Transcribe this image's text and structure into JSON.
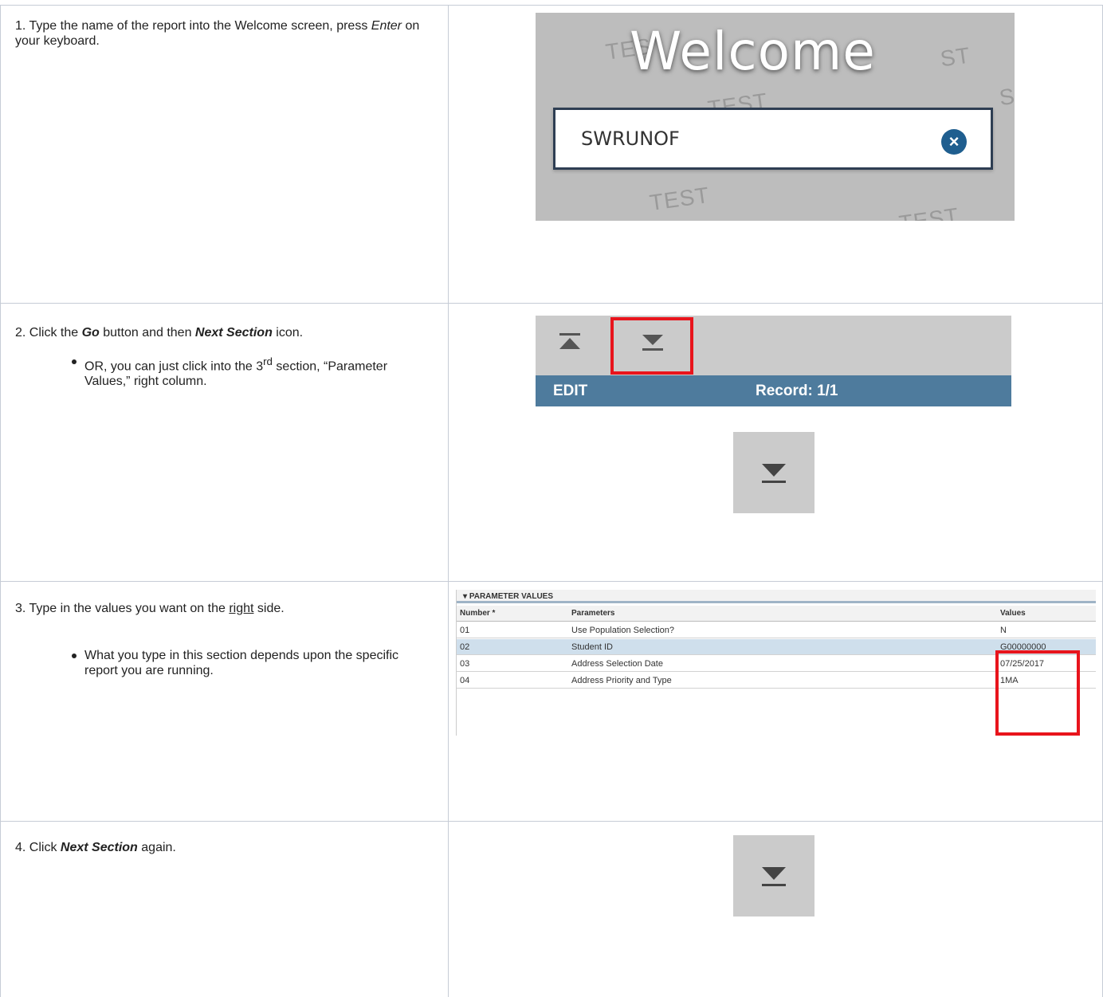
{
  "steps": [
    {
      "text_before": "1. Type the name of the report into the Welcome screen, press ",
      "em": "Enter",
      "text_after": " on your keyboard."
    },
    {
      "text_1": "2. Click the ",
      "em1": "Go",
      "text_2": " button and then ",
      "em2": "Next Section",
      "text_3": " icon.",
      "bullet_before": "OR, you can just click into the 3",
      "bullet_sup": "rd",
      "bullet_after": " section, “Parameter Values,” right column."
    },
    {
      "text_before": "3. Type in the values you want on the ",
      "underlined": "right",
      "text_after": " side.",
      "bullet": "What you type in this section depends upon the specific report you are running."
    },
    {
      "text_1": "4. Click ",
      "em": "Next Section",
      "text_2": " again."
    }
  ],
  "welcome_screen": {
    "title": "Welcome",
    "watermark": "TEST",
    "watermark_partial_1": "TES",
    "watermark_partial_2": "ST",
    "watermark_partial_3": "S",
    "input_value": "SWRUNOF",
    "clear_icon": "close-circle-icon"
  },
  "toolbar": {
    "mode": "EDIT",
    "record": "Record: 1/1",
    "icons": [
      "previous-section-icon",
      "next-section-icon"
    ],
    "highlight_color": "#e8141c",
    "bar_color": "#4e7b9d"
  },
  "parameter_values": {
    "section_title": "PARAMETER VALUES",
    "columns": [
      "Number *",
      "Parameters",
      "Values"
    ],
    "rows": [
      {
        "number": "01",
        "parameter": "Use Population Selection?",
        "value": "N"
      },
      {
        "number": "02",
        "parameter": "Student ID",
        "value": "G00000000"
      },
      {
        "number": "03",
        "parameter": "Address Selection Date",
        "value": "07/25/2017"
      },
      {
        "number": "04",
        "parameter": "Address Priority and Type",
        "value": "1MA"
      }
    ]
  }
}
